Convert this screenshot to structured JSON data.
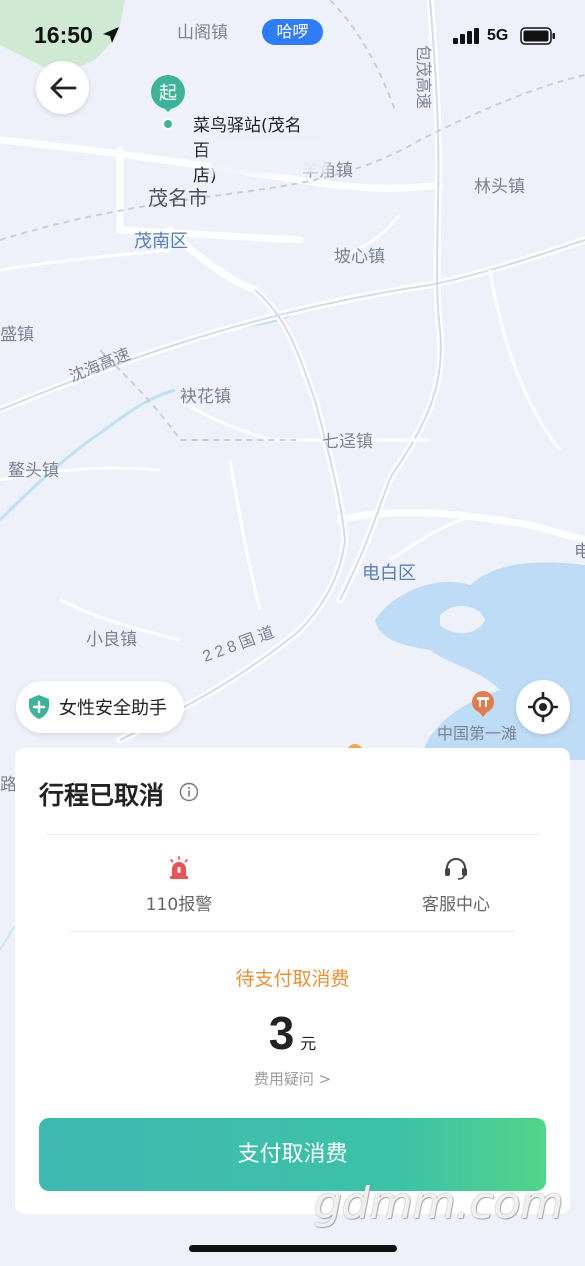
{
  "status_bar": {
    "time": "16:50",
    "app_badge": "哈啰",
    "network": "5G"
  },
  "map": {
    "start_marker": "起",
    "start_label_line1": "菜鸟驿站(茂名",
    "start_label_line2": "百",
    "start_label_line3": "店)",
    "place_labels": {
      "shange": "山阁镇",
      "baomao": "包茂高速",
      "yangjiao": "羊角镇",
      "linto": "林头镇",
      "maoming": "茂名市",
      "maonan": "茂南区",
      "poxin": "坡心镇",
      "sheng": "盛镇",
      "shenhai": "沈海高速",
      "yihua": "袂花镇",
      "qijing": "七迳镇",
      "aotou": "鳌头镇",
      "dianbai": "电白区",
      "xiaoliang": "小良镇",
      "road228": "228国道",
      "lu": "路",
      "dian": "电"
    },
    "poi_label": "中国第一滩"
  },
  "safety_assistant": {
    "label": "女性安全助手",
    "icon": "shield-plus-icon"
  },
  "trip_card": {
    "title": "行程已取消",
    "actions": [
      {
        "label": "110报警",
        "icon": "alarm-icon"
      },
      {
        "label": "客服中心",
        "icon": "headset-icon"
      }
    ],
    "pending_text": "待支付取消费",
    "amount": "3",
    "unit": "元",
    "fee_question": "费用疑问 >",
    "pay_button": "支付取消费"
  },
  "watermark": "gdmm.com",
  "colors": {
    "accent_green": "#3fb9b0",
    "pending_orange": "#e8913a",
    "app_badge_blue": "#2f7cf6",
    "start_pin_green": "#3fb39a",
    "alarm_red": "#e85454"
  }
}
